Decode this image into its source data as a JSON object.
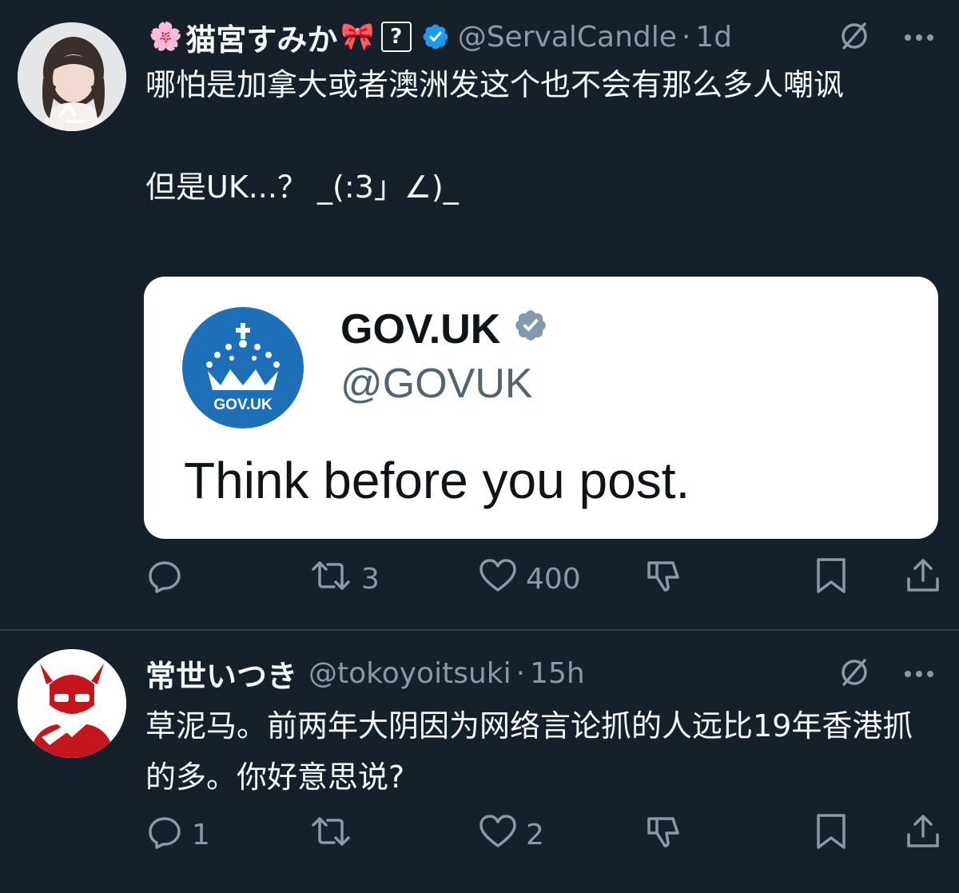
{
  "colors": {
    "background": "#15202b",
    "text": "#f7f9f9",
    "secondary": "#8b98a5",
    "verified_blue": "#1d9bf0",
    "govuk_blue": "#1d70b8",
    "divider": "#2f3b47"
  },
  "tweets": [
    {
      "name": "猫宮すみか",
      "emoji_before": "🌸",
      "emoji_after": "🎀",
      "help_badge": "?",
      "verified": true,
      "handle": "@ServalCandle",
      "separator": "·",
      "time": "1d",
      "text": "哪怕是加拿大或者澳洲发这个也不会有那么多人嘲讽\n\n但是UK...？ _(:3」∠)_",
      "quote": {
        "logo_text": "GOV.UK",
        "name": "GOV.UK",
        "handle": "@GOVUK",
        "body": "Think before you post."
      },
      "stats": {
        "replies": "",
        "retweets": "3",
        "likes": "400"
      },
      "icons": [
        "grok-icon",
        "more-icon",
        "reply-icon",
        "retweet-icon",
        "like-icon",
        "dislike-icon",
        "bookmark-icon",
        "share-icon"
      ]
    },
    {
      "name": "常世いつき",
      "handle": "@tokoyoitsuki",
      "separator": "·",
      "time": "15h",
      "text": "草泥马。前两年大阴因为网络言论抓的人远比19年香港抓的多。你好意思说?",
      "stats": {
        "replies": "1",
        "retweets": "",
        "likes": "2"
      }
    }
  ]
}
